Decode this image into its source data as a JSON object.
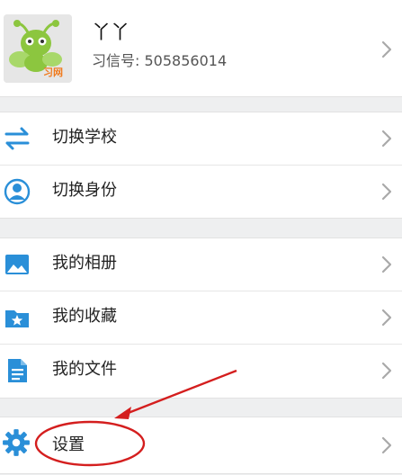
{
  "profile": {
    "name": "丫丫",
    "id_label": "习信号:",
    "id_value": "505856014",
    "avatar_text": "习网"
  },
  "group1": [
    {
      "label": "切换学校",
      "icon": "swap-arrows-icon"
    },
    {
      "label": "切换身份",
      "icon": "person-circle-icon"
    }
  ],
  "group2": [
    {
      "label": "我的相册",
      "icon": "image-icon"
    },
    {
      "label": "我的收藏",
      "icon": "folder-star-icon"
    },
    {
      "label": "我的文件",
      "icon": "document-icon"
    }
  ],
  "group3": [
    {
      "label": "设置",
      "icon": "gear-icon"
    }
  ],
  "colors": {
    "icon_blue": "#2a8fd8",
    "annotation_red": "#d41e1e",
    "chevron": "#a9a9a9",
    "background": "#eeeff0"
  }
}
